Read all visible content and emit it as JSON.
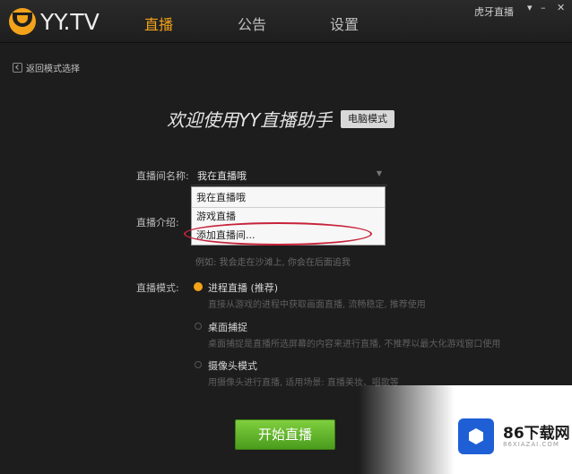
{
  "header": {
    "logo_text": "YY.TV",
    "nav": [
      "直播",
      "公告",
      "设置"
    ],
    "user": "虎牙直播",
    "window": {
      "down": "▾",
      "min": "–",
      "close": "✕"
    }
  },
  "back_label": "返回模式选择",
  "welcome": {
    "title": "欢迎使用YY直播助手",
    "mode_badge": "电脑模式"
  },
  "form": {
    "room_name_label": "直播间名称:",
    "room_name_value": "我在直播哦",
    "intro_label": "直播介绍:",
    "dropdown_options": [
      "我在直播哦",
      "游戏直播",
      "添加直播间..."
    ],
    "example": "例如: 我会走在沙滩上, 你会在后面追我",
    "mode_label": "直播模式:",
    "modes": [
      {
        "title": "进程直播 (推荐)",
        "desc": "直接从游戏的进程中获取画面直播, 流畅稳定, 推荐使用"
      },
      {
        "title": "桌面捕捉",
        "desc": "桌面捕捉是直播所选屏幕的内容来进行直播, 不推荐以最大化游戏窗口使用"
      },
      {
        "title": "摄像头模式",
        "desc": "用摄像头进行直播, 适用场景: 直播美妆、唱歌等"
      }
    ]
  },
  "start_button": "开始直播",
  "watermark": {
    "text": "86下载网",
    "sub": "86XIAZAI.COM"
  },
  "colors": {
    "accent": "#f3a21a",
    "start_green": "#5cb82a",
    "highlight_red": "#c6233a"
  }
}
